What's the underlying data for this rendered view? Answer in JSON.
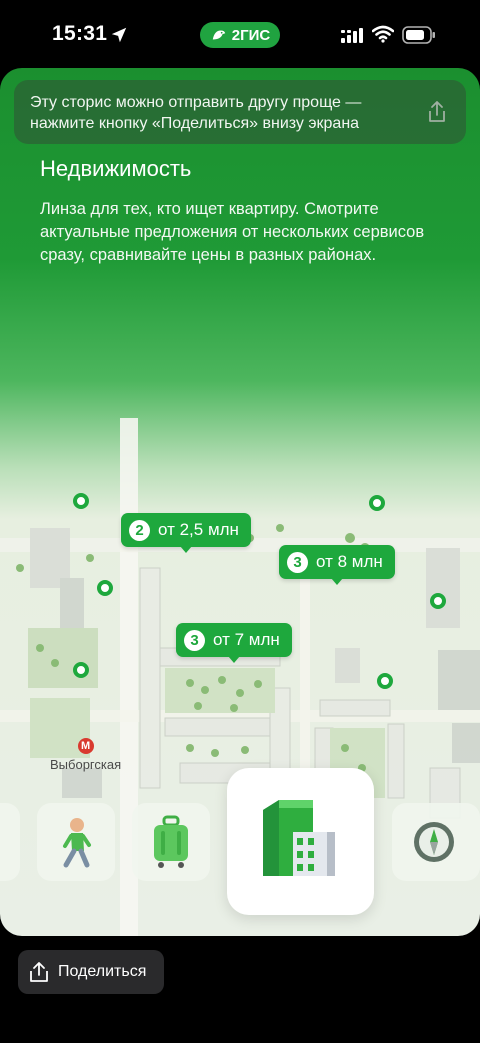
{
  "status_bar": {
    "time": "15:31",
    "app_badge": "2ГИС",
    "icons": [
      "location-arrow-icon",
      "signal-icon",
      "wifi-icon",
      "battery-icon"
    ]
  },
  "story": {
    "hint": "Эту сторис можно отправить другу проще — нажмите кнопку «Поделиться» внизу экрана",
    "title": "Недвижимость",
    "description": "Линза для тех, кто ищет квартиру. Смотрите актуальные предложения от нескольких сервисов сразу, сравнивайте цены в разных районах."
  },
  "map": {
    "pins": [
      {
        "count": "2",
        "label": "от 2,5 млн"
      },
      {
        "count": "3",
        "label": "от 8 млн"
      },
      {
        "count": "3",
        "label": "от 7 млн"
      }
    ],
    "metro_label": "Выборгская"
  },
  "lenses": [
    {
      "icon": "walking-person-icon"
    },
    {
      "icon": "suitcase-icon"
    },
    {
      "icon": "buildings-icon",
      "selected": true
    },
    {
      "icon": "compass-icon"
    }
  ],
  "share_button": {
    "label": "Поделиться"
  },
  "colors": {
    "accent": "#1ea83d",
    "background": "#000000"
  }
}
